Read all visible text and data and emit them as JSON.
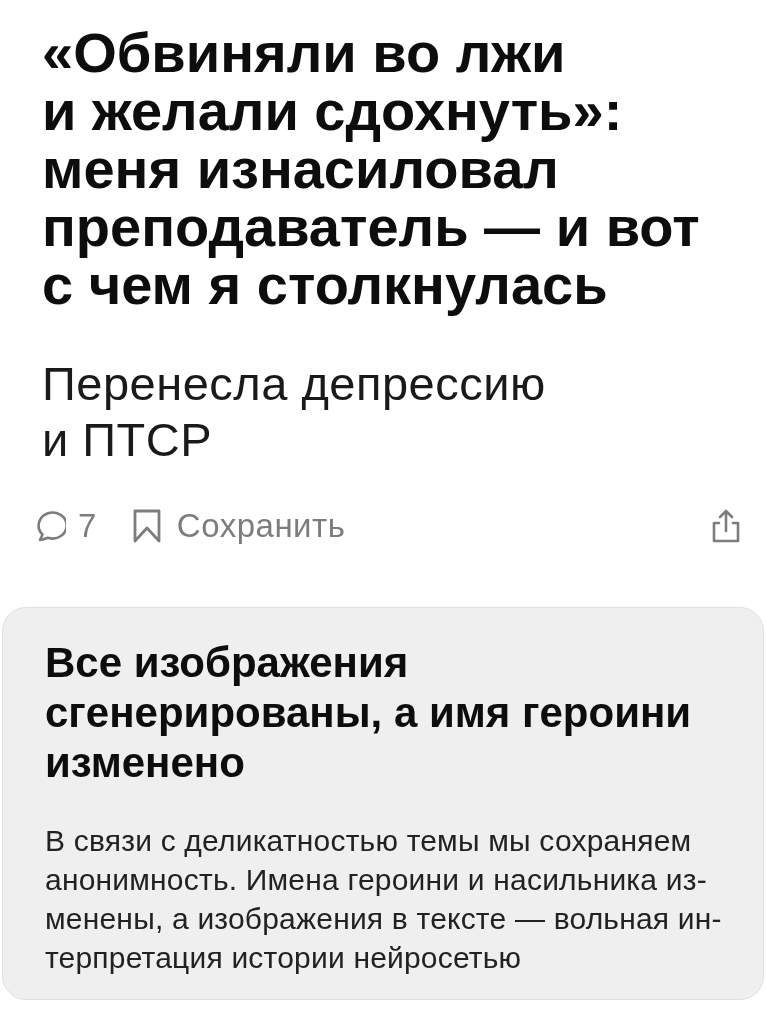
{
  "article": {
    "title": "«Обвиняли во лжи\nи желали сдохнуть»:\nменя изнасиловал\nпреподаватель — и вот\nс чем я столкнулась",
    "subtitle": "Перенесла депрессию\nи ПТСР"
  },
  "actions": [
    {
      "kind": "comments",
      "label": "7"
    },
    {
      "kind": "save",
      "label": "Сохранить"
    },
    {
      "kind": "share"
    }
  ],
  "notice": {
    "title": "Все изображения\nсгенерированы, а имя героини\nизменено",
    "text": "В связи с деликатностью темы мы сохраняем\nанонимность. Имена героини и насильника из-\nменены, а изображения в тексте — вольная ин-\nтерпретация истории нейросетью"
  }
}
